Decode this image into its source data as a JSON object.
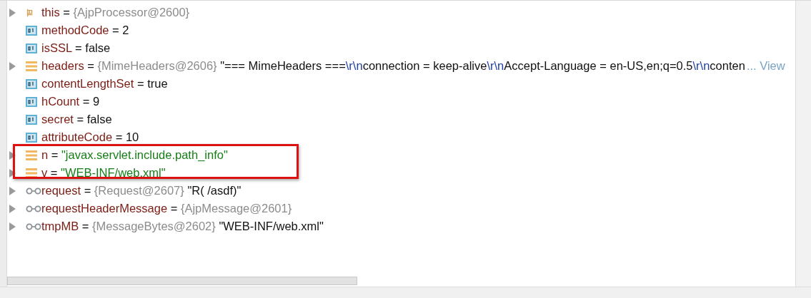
{
  "variables": [
    {
      "name": "this",
      "kind": "object",
      "separator": "=",
      "expandable": true,
      "boxed": false,
      "value": [
        {
          "kind": "type",
          "text": "{AjpProcessor@2600}"
        }
      ]
    },
    {
      "name": "methodCode",
      "kind": "primitive",
      "separator": "=",
      "expandable": false,
      "boxed": false,
      "value": [
        {
          "kind": "plain",
          "text": "2"
        }
      ]
    },
    {
      "name": "isSSL",
      "kind": "primitive",
      "separator": "=",
      "expandable": false,
      "boxed": false,
      "value": [
        {
          "kind": "plain",
          "text": "false"
        }
      ]
    },
    {
      "name": "headers",
      "kind": "field",
      "separator": "=",
      "expandable": true,
      "boxed": false,
      "value": [
        {
          "kind": "type",
          "text": "{MimeHeaders@2606}"
        },
        {
          "kind": "plain",
          "text": "\"=== MimeHeaders ==="
        },
        {
          "kind": "escape",
          "text": "\\r\\n"
        },
        {
          "kind": "plain",
          "text": "connection = keep-alive"
        },
        {
          "kind": "escape",
          "text": "\\r\\n"
        },
        {
          "kind": "plain",
          "text": "Accept-Language = en-US,en;q=0.5"
        },
        {
          "kind": "escape",
          "text": "\\r\\n"
        },
        {
          "kind": "plain",
          "text": "conten"
        }
      ],
      "view_link": "... View"
    },
    {
      "name": "contentLengthSet",
      "kind": "primitive",
      "separator": "=",
      "expandable": false,
      "boxed": false,
      "value": [
        {
          "kind": "plain",
          "text": "true"
        }
      ]
    },
    {
      "name": "hCount",
      "kind": "primitive",
      "separator": "=",
      "expandable": false,
      "boxed": false,
      "value": [
        {
          "kind": "plain",
          "text": "9"
        }
      ]
    },
    {
      "name": "secret",
      "kind": "primitive",
      "separator": "=",
      "expandable": false,
      "boxed": false,
      "value": [
        {
          "kind": "plain",
          "text": "false"
        }
      ]
    },
    {
      "name": "attributeCode",
      "kind": "primitive",
      "separator": "=",
      "expandable": false,
      "boxed": false,
      "value": [
        {
          "kind": "plain",
          "text": "10"
        }
      ]
    },
    {
      "name": "n",
      "kind": "field",
      "separator": "=",
      "expandable": true,
      "boxed": true,
      "value": [
        {
          "kind": "string",
          "text": "\"javax.servlet.include.path_info\""
        }
      ]
    },
    {
      "name": "v",
      "kind": "field",
      "separator": "=",
      "expandable": true,
      "boxed": true,
      "value": [
        {
          "kind": "string",
          "text": "\"WEB-INF/web.xml\""
        }
      ]
    },
    {
      "name": "request",
      "kind": "watch",
      "separator": "=",
      "expandable": true,
      "boxed": false,
      "value": [
        {
          "kind": "type",
          "text": "{Request@2607}"
        },
        {
          "kind": "plain",
          "text": "\"R( /asdf)\""
        }
      ]
    },
    {
      "name": "requestHeaderMessage",
      "kind": "watch",
      "separator": "=",
      "expandable": true,
      "boxed": false,
      "value": [
        {
          "kind": "type",
          "text": "{AjpMessage@2601}"
        }
      ]
    },
    {
      "name": "tmpMB",
      "kind": "watch",
      "separator": "=",
      "expandable": true,
      "boxed": false,
      "value": [
        {
          "kind": "type",
          "text": "{MessageBytes@2602}"
        },
        {
          "kind": "plain",
          "text": "\"WEB-INF/web.xml\""
        }
      ]
    }
  ]
}
